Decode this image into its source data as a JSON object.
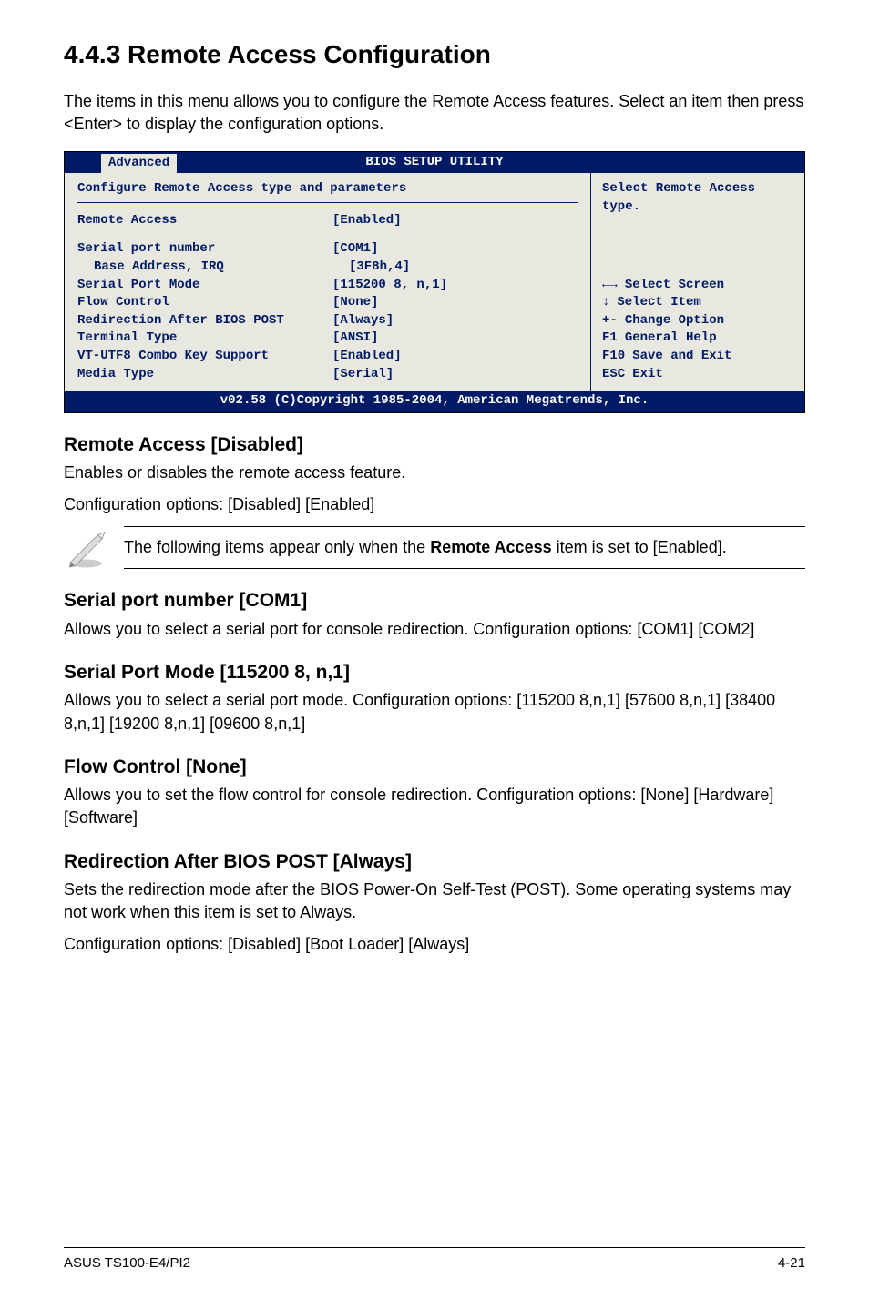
{
  "section_number": "4.4.3 Remote Access Configuration",
  "intro": "The items in this menu allows you to configure the Remote Access features. Select an item then press <Enter> to display the configuration options.",
  "bios": {
    "title": "BIOS SETUP UTILITY",
    "tab": "Advanced",
    "header": "Configure Remote Access type and parameters",
    "rows": [
      {
        "label": "Remote Access",
        "value": "[Enabled]"
      },
      {
        "label": "Serial port number",
        "value": "[COM1]"
      },
      {
        "label": "Base Address, IRQ",
        "value": "[3F8h,4]",
        "indent": true
      },
      {
        "label": "Serial Port Mode",
        "value": "[115200 8, n,1]"
      },
      {
        "label": "Flow Control",
        "value": "[None]"
      },
      {
        "label": "Redirection After BIOS POST",
        "value": "[Always]"
      },
      {
        "label": "Terminal Type",
        "value": "[ANSI]"
      },
      {
        "label": "VT-UTF8 Combo Key Support",
        "value": "[Enabled]"
      },
      {
        "label": "Media Type",
        "value": "[Serial]"
      }
    ],
    "help": "Select Remote Access type.",
    "nav": {
      "select_screen": "Select Screen",
      "select_item": "Select Item",
      "change_option_key": "+-",
      "change_option": "Change Option",
      "general_help_key": "F1",
      "general_help": "General Help",
      "save_exit_key": "F10",
      "save_exit": "Save and Exit",
      "esc_key": "ESC",
      "esc": "Exit"
    },
    "footer": "v02.58 (C)Copyright 1985-2004, American Megatrends, Inc."
  },
  "sub1": {
    "title": "Remote Access [Disabled]",
    "line1": "Enables or disables the remote access feature.",
    "line2": "Configuration options: [Disabled] [Enabled]"
  },
  "note": {
    "prefix": "The following items appear only when the ",
    "bold": "Remote Access",
    "suffix": " item is set to [Enabled]."
  },
  "sub2": {
    "title": "Serial port number [COM1]",
    "text": "Allows you to select a serial port for console redirection. Configuration options: [COM1] [COM2]"
  },
  "sub3": {
    "title": "Serial Port Mode [115200 8, n,1]",
    "text": "Allows you to select a serial port mode. Configuration options: [115200 8,n,1] [57600 8,n,1] [38400 8,n,1] [19200 8,n,1] [09600 8,n,1]"
  },
  "sub4": {
    "title": "Flow Control [None]",
    "text": "Allows you to set the flow control for console redirection. Configuration options: [None] [Hardware] [Software]"
  },
  "sub5": {
    "title": "Redirection After BIOS POST [Always]",
    "line1": "Sets the redirection mode after the BIOS Power-On Self-Test (POST). Some operating systems may not work when this item is set to Always.",
    "line2": "Configuration options: [Disabled] [Boot Loader] [Always]"
  },
  "footer": {
    "left": "ASUS TS100-E4/PI2",
    "right": "4-21"
  }
}
